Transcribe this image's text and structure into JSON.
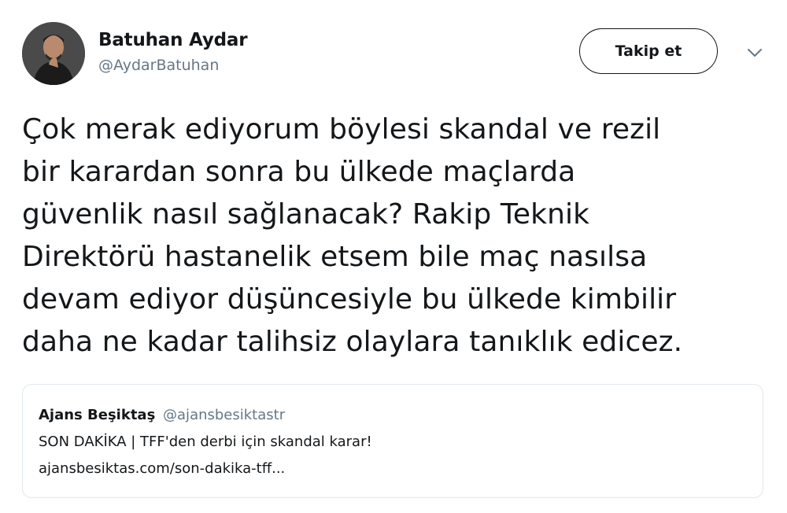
{
  "author": {
    "display_name": "Batuhan Aydar",
    "handle": "@AydarBatuhan"
  },
  "follow_button_label": "Takip et",
  "tweet": {
    "lines": [
      "Çok merak ediyorum böylesi skandal ve rezil",
      "bir karardan sonra bu ülkede maçlarda",
      "güvenlik nasıl sağlanacak? Rakip Teknik",
      "Direktörü hastanelik etsem bile maç nasılsa",
      "devam ediyor düşüncesiyle bu ülkede kimbilir",
      "daha ne kadar talihsiz olaylara tanıklık edicez."
    ]
  },
  "quoted": {
    "display_name": "Ajans Beşiktaş",
    "handle": "@ajansbesiktastr",
    "text": "SON DAKİKA | TFF'den derbi için skandal karar!",
    "link": "ajansbesiktas.com/son-dakika-tff..."
  },
  "icons": {
    "avatar": "profile-photo",
    "menu": "chevron-down-icon"
  },
  "colors": {
    "text": "#14171a",
    "secondary": "#657786",
    "border": "#e1e8ed"
  }
}
